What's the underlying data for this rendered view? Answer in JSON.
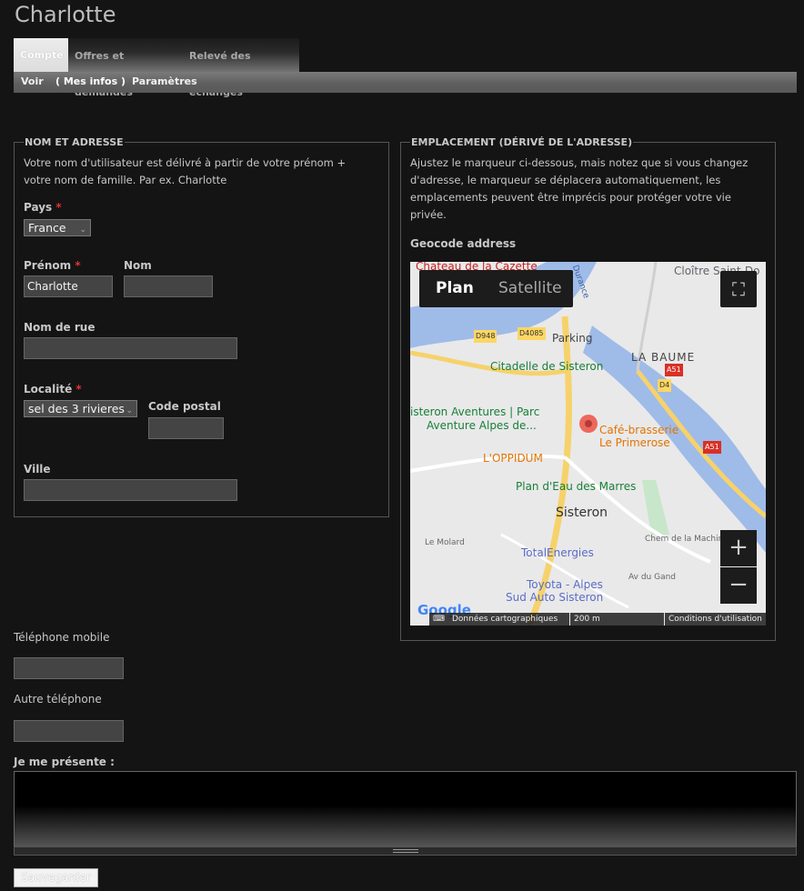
{
  "page_title": "Charlotte",
  "tabs": [
    {
      "label": "Compte"
    },
    {
      "label": "Offres et demandes"
    },
    {
      "label": "Relevé des échanges"
    }
  ],
  "subnav": [
    {
      "label": "Voir"
    },
    {
      "label": "( Mes infos )"
    },
    {
      "label": "Paramètres"
    }
  ],
  "name_address": {
    "legend": "NOM ET ADRESSE",
    "help_line1": "Votre nom d'utilisateur est délivré à partir de votre prénom +",
    "help_line2": "votre nom de famille. Par ex. Charlotte",
    "country_label": "Pays",
    "country_value": "France",
    "required_mark": "*",
    "firstname_label": "Prénom",
    "firstname_value": "Charlotte",
    "lastname_label": "Nom",
    "lastname_value": "",
    "street_label": "Nom de rue",
    "street_value": "",
    "locality_label": "Localité",
    "locality_value": "sel des 3 rivieres",
    "postal_label": "Code postal",
    "postal_value": "",
    "city_label": "Ville",
    "city_value": ""
  },
  "location": {
    "legend": "EMPLACEMENT (DÉRIVÉ DE L'ADRESSE)",
    "help_line1": "Ajustez le marqueur ci-dessous, mais notez que si vous changez",
    "help_line2": "d'adresse, le marqueur se déplacera automatiquement, les",
    "help_line3": "emplacements peuvent être imprécis pour protéger votre vie",
    "help_line4": "privée.",
    "geocode_label": "Geocode address",
    "map": {
      "type_plan": "Plan",
      "type_satellite": "Satellite",
      "zoom_in": "+",
      "zoom_out": "−",
      "poi": {
        "chateau": "Chateau de la Cazette",
        "cloitre": "Cloître Saint-Do",
        "parking": "Parking",
        "la_baume": "LA BAUME",
        "citadelle": "Citadelle de Sisteron",
        "aventures_1": "isteron Aventures | Parc",
        "aventures_2": "Aventure Alpes de...",
        "cafe_1": "Café-brasserie",
        "cafe_2": "Le Primerose",
        "oppidum": "L'OPPIDUM",
        "plan_eau": "Plan d'Eau des Marres",
        "sisteron": "Sisteron",
        "le_molard": "Le Molard",
        "total": "TotalEnergies",
        "chem": "Chem de la Machin",
        "av_gand": "Av du Gand",
        "toyota_1": "Toyota - Alpes",
        "toyota_2": "Sud Auto Sisteron",
        "d948": "D948",
        "d4085": "D4085",
        "a51a": "A51",
        "d4": "D4",
        "a51b": "A51",
        "durance": "Durance",
        "google": "Google"
      },
      "attrib_data": "Données cartographiques",
      "attrib_scale": "200 m",
      "attrib_terms": "Conditions d'utilisation"
    }
  },
  "phone": {
    "mobile_label": "Téléphone mobile",
    "mobile_value": "",
    "other_label": "Autre téléphone",
    "other_value": ""
  },
  "about": {
    "label": "Je me présente :",
    "value": ""
  },
  "save_label": "Sauvegarder"
}
